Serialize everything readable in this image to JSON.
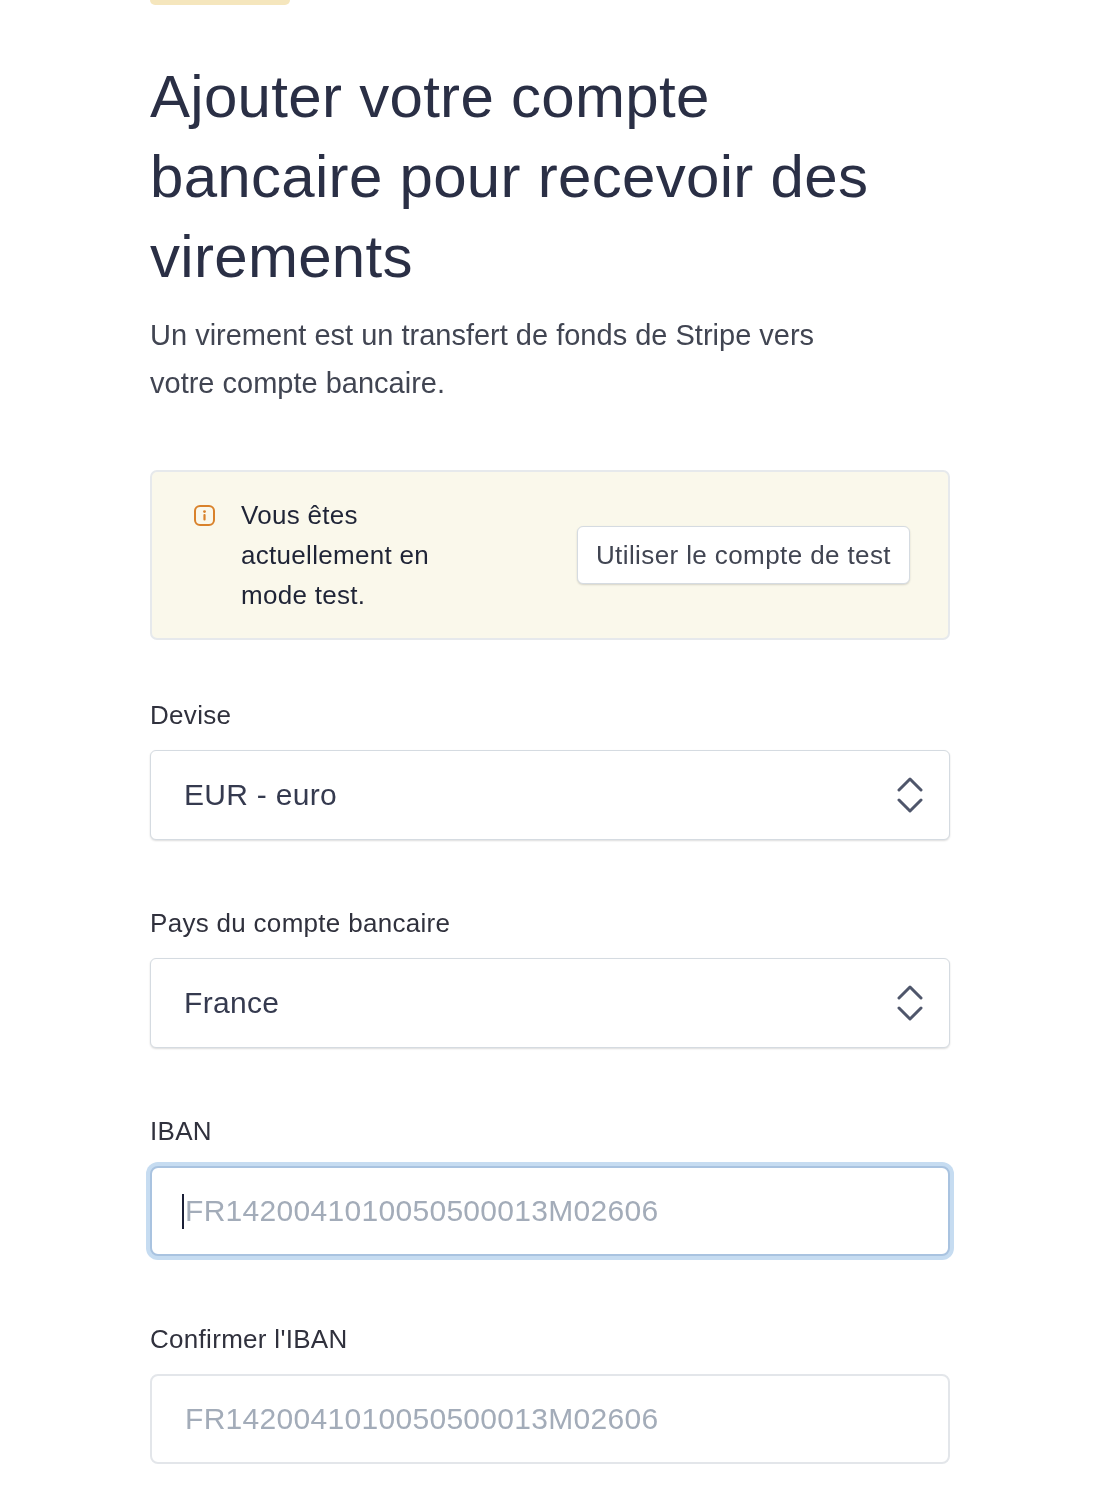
{
  "heading": "Ajouter votre compte bancaire pour recevoir des virements",
  "intro": "Un virement est un transfert de fonds de Stripe vers votre compte bancaire.",
  "notice": {
    "message": "Vous êtes actuellement en mode test.",
    "button": "Utiliser le compte de test"
  },
  "fields": [
    {
      "kind": "select",
      "label": "Devise",
      "value": "EUR - euro"
    },
    {
      "kind": "select",
      "label": "Pays du compte bancaire",
      "value": "France"
    },
    {
      "kind": "text",
      "label": "IBAN",
      "placeholder": "FR1420041010050500013M02606",
      "focused": true
    },
    {
      "kind": "text",
      "label": "Confirmer l'IBAN",
      "placeholder": "FR1420041010050500013M02606",
      "focused": false
    }
  ]
}
